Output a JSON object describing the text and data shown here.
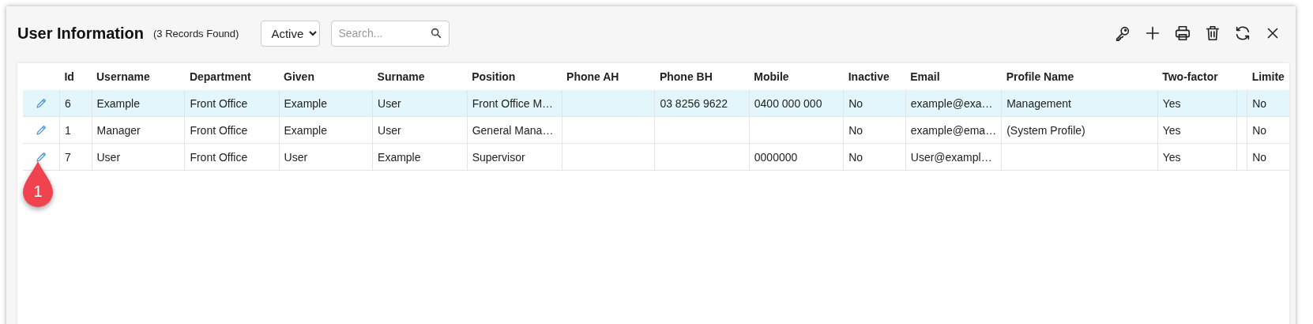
{
  "header": {
    "title": "User Information",
    "record_count": "(3 Records Found)",
    "filter": {
      "value": "Active"
    },
    "search": {
      "placeholder": "Search..."
    }
  },
  "table": {
    "columns": [
      "Id",
      "Username",
      "Department",
      "Given",
      "Surname",
      "Position",
      "Phone AH",
      "Phone BH",
      "Mobile",
      "Inactive",
      "Email",
      "Profile Name",
      "Two-factor",
      null,
      "Limite"
    ],
    "rows": [
      {
        "selected": true,
        "cells": [
          "6",
          "Example",
          "Front Office",
          "Example",
          "User",
          "Front Office M…",
          null,
          "03 8256 9622",
          "0400 000 000",
          "No",
          "example@exa…",
          "Management",
          "Yes",
          null,
          "No"
        ]
      },
      {
        "selected": false,
        "cells": [
          "1",
          "Manager",
          "Front Office",
          "Example",
          "User",
          "General Mana…",
          null,
          null,
          null,
          "No",
          "example@ema…",
          "(System Profile)",
          "Yes",
          null,
          "No"
        ]
      },
      {
        "selected": false,
        "cells": [
          "7",
          "User",
          "Front Office",
          "User",
          "Example",
          "Supervisor",
          null,
          null,
          "0000000",
          "No",
          "User@exampl…",
          null,
          "Yes",
          null,
          "No"
        ]
      }
    ]
  },
  "callout": {
    "label": "1"
  }
}
